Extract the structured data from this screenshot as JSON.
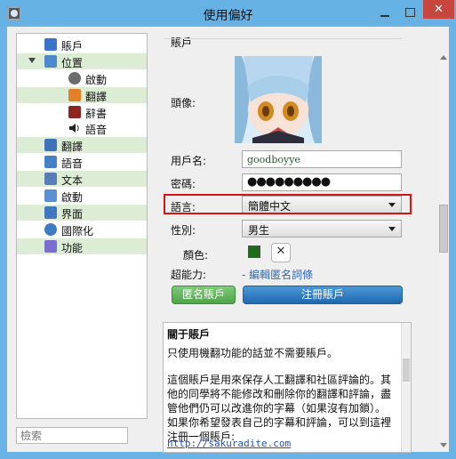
{
  "window": {
    "title": "使用偏好",
    "close_glyph": "✕"
  },
  "sidebar": {
    "items": [
      {
        "label": "賬戶",
        "icon": "user-icon",
        "highlight": false
      },
      {
        "label": "位置",
        "icon": "people-icon",
        "highlight": true
      },
      {
        "label": "啟動",
        "icon": "boot-icon",
        "highlight": false
      },
      {
        "label": "翻譯",
        "icon": "translate-icon",
        "highlight": true
      },
      {
        "label": "辭書",
        "icon": "dictionary-icon",
        "highlight": false
      },
      {
        "label": "語音",
        "icon": "speaker-icon",
        "highlight": false
      },
      {
        "label": "翻譯",
        "icon": "translate-icon",
        "highlight": true
      },
      {
        "label": "語音",
        "icon": "music-icon",
        "highlight": false
      },
      {
        "label": "文本",
        "icon": "text-icon",
        "highlight": true
      },
      {
        "label": "啟動",
        "icon": "boot-icon",
        "highlight": false
      },
      {
        "label": "界面",
        "icon": "monitor-icon",
        "highlight": true
      },
      {
        "label": "國際化",
        "icon": "globe-icon",
        "highlight": false
      },
      {
        "label": "功能",
        "icon": "plugin-icon",
        "highlight": true
      }
    ],
    "search_placeholder": "檢索"
  },
  "account": {
    "section_title": "賬戶",
    "avatar_label": "頭像:",
    "username_label": "用戶名:",
    "username_value": "goodboyye",
    "password_label": "密碼:",
    "password_value": "●●●●●●●●●",
    "language_label": "語言:",
    "language_value": "簡體中文",
    "gender_label": "性別:",
    "gender_value": "男生",
    "color_label": "顏色:",
    "color_clear_glyph": "✕",
    "ability_label": "超能力:",
    "ability_link": "- 編輯匿名詞條",
    "anonymous_button": "匿名賬戶",
    "register_button": "注冊賬戶"
  },
  "about": {
    "title": "關于賬戶",
    "para1": "只使用機翻功能的話並不需要賬戶。",
    "para2": "這個賬戶是用來保存人工翻譯和社區評論的。其他的同學將不能修改和刪除你的翻譯和評論，盡管他們仍可以改進你的字幕（如果沒有加鎖）。 如果你希望發表自己的字幕和評論，可以到這裡注冊一個賬戶:",
    "url": "http://sakuradite.com"
  },
  "colors": {
    "selected_color": "#1c6d18",
    "accent_blue": "#1e69b1",
    "accent_green": "#4ea548",
    "highlight_bg": "#dcecd5",
    "window_bg": "#69b3e6"
  }
}
